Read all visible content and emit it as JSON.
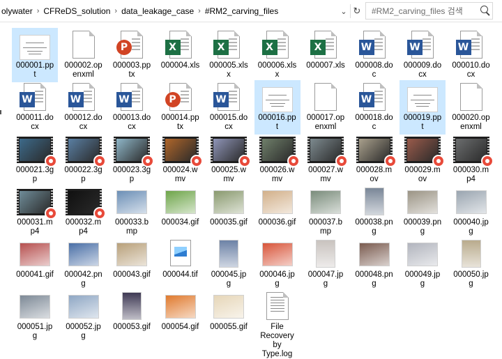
{
  "address": {
    "crumbs": [
      "olywater",
      "CFReDS_solution",
      "data_leakage_case",
      "#RM2_carving_files"
    ],
    "separator": "›",
    "dropdown_glyph": "⌄",
    "refresh_glyph": "↻"
  },
  "search": {
    "placeholder": "#RM2_carving_files 검색"
  },
  "files": [
    {
      "line1": "000001.pp",
      "line2": "t",
      "kind": "ppt-thumb",
      "selected": true
    },
    {
      "line1": "000002.op",
      "line2": "enxml",
      "kind": "blank"
    },
    {
      "line1": "000003.pp",
      "line2": "tx",
      "kind": "ppt"
    },
    {
      "line1": "000004.xls",
      "line2": "",
      "kind": "xls"
    },
    {
      "line1": "000005.xls",
      "line2": "x",
      "kind": "xls"
    },
    {
      "line1": "000006.xls",
      "line2": "x",
      "kind": "xls"
    },
    {
      "line1": "000007.xls",
      "line2": "",
      "kind": "xls"
    },
    {
      "line1": "000008.do",
      "line2": "c",
      "kind": "doc"
    },
    {
      "line1": "000009.do",
      "line2": "cx",
      "kind": "doc"
    },
    {
      "line1": "000010.do",
      "line2": "cx",
      "kind": "doc"
    },
    {
      "line1": "000011.do",
      "line2": "cx",
      "kind": "doc"
    },
    {
      "line1": "000012.do",
      "line2": "cx",
      "kind": "doc"
    },
    {
      "line1": "000013.do",
      "line2": "cx",
      "kind": "doc"
    },
    {
      "line1": "000014.pp",
      "line2": "tx",
      "kind": "ppt"
    },
    {
      "line1": "000015.do",
      "line2": "cx",
      "kind": "doc"
    },
    {
      "line1": "000016.pp",
      "line2": "t",
      "kind": "ppt-thumb",
      "selected": true
    },
    {
      "line1": "000017.op",
      "line2": "enxml",
      "kind": "blank"
    },
    {
      "line1": "000018.do",
      "line2": "c",
      "kind": "doc"
    },
    {
      "line1": "000019.pp",
      "line2": "t",
      "kind": "ppt-thumb",
      "selected": true
    },
    {
      "line1": "000020.op",
      "line2": "enxml",
      "kind": "blank"
    },
    {
      "line1": "000021.3g",
      "line2": "p",
      "kind": "video",
      "color": "#3d6a8a"
    },
    {
      "line1": "000022.3g",
      "line2": "p",
      "kind": "video",
      "color": "#5a7fa3"
    },
    {
      "line1": "000023.3g",
      "line2": "p",
      "kind": "video",
      "color": "#8fb7c9"
    },
    {
      "line1": "000024.w",
      "line2": "mv",
      "kind": "video",
      "color": "#b0662a"
    },
    {
      "line1": "000025.w",
      "line2": "mv",
      "kind": "video",
      "color": "#8f95b8"
    },
    {
      "line1": "000026.w",
      "line2": "mv",
      "kind": "video",
      "color": "#6f7f6a"
    },
    {
      "line1": "000027.w",
      "line2": "mv",
      "kind": "video",
      "color": "#7d8a8f"
    },
    {
      "line1": "000028.m",
      "line2": "ov",
      "kind": "video",
      "color": "#a9a08c"
    },
    {
      "line1": "000029.m",
      "line2": "ov",
      "kind": "video",
      "color": "#9a5b4b"
    },
    {
      "line1": "000030.m",
      "line2": "p4",
      "kind": "video",
      "color": "#6b6d6e"
    },
    {
      "line1": "000031.m",
      "line2": "p4",
      "kind": "video",
      "color": "#6f8c98"
    },
    {
      "line1": "000032.m",
      "line2": "p4",
      "kind": "video",
      "color": "#101010"
    },
    {
      "line1": "000033.b",
      "line2": "mp",
      "kind": "image",
      "color": "#6c8fb6"
    },
    {
      "line1": "000034.gif",
      "line2": "",
      "kind": "image",
      "color": "#6ea54a"
    },
    {
      "line1": "000035.gif",
      "line2": "",
      "kind": "image",
      "color": "#8a9a6f"
    },
    {
      "line1": "000036.gif",
      "line2": "",
      "kind": "image",
      "color": "#d2b08a"
    },
    {
      "line1": "000037.b",
      "line2": "mp",
      "kind": "image",
      "color": "#7a8c7b"
    },
    {
      "line1": "000038.pn",
      "line2": "g",
      "kind": "image-tall",
      "color": "#7a8798"
    },
    {
      "line1": "000039.pn",
      "line2": "g",
      "kind": "image",
      "color": "#9b9485"
    },
    {
      "line1": "000040.jp",
      "line2": "g",
      "kind": "image",
      "color": "#9aa5b0"
    },
    {
      "line1": "000041.gif",
      "line2": "",
      "kind": "image",
      "color": "#b6504f"
    },
    {
      "line1": "000042.pn",
      "line2": "g",
      "kind": "image",
      "color": "#4a6fa6"
    },
    {
      "line1": "000043.gif",
      "line2": "",
      "kind": "image",
      "color": "#b8a07a"
    },
    {
      "line1": "000044.tif",
      "line2": "",
      "kind": "tif"
    },
    {
      "line1": "000045.jp",
      "line2": "g",
      "kind": "image-tall",
      "color": "#6d82a6"
    },
    {
      "line1": "000046.jp",
      "line2": "g",
      "kind": "image",
      "color": "#d8553a"
    },
    {
      "line1": "000047.jp",
      "line2": "g",
      "kind": "image-tall",
      "color": "#c9c3bf"
    },
    {
      "line1": "000048.pn",
      "line2": "g",
      "kind": "image",
      "color": "#7a5b4f"
    },
    {
      "line1": "000049.jp",
      "line2": "g",
      "kind": "image",
      "color": "#b1b4bd"
    },
    {
      "line1": "000050.jp",
      "line2": "g",
      "kind": "image-tall",
      "color": "#b9ab8d"
    },
    {
      "line1": "000051.jp",
      "line2": "g",
      "kind": "image",
      "color": "#7d8996"
    },
    {
      "line1": "000052.jp",
      "line2": "g",
      "kind": "image",
      "color": "#8fa7c4"
    },
    {
      "line1": "000053.gif",
      "line2": "",
      "kind": "image-tall",
      "color": "#3f3a55"
    },
    {
      "line1": "000054.gif",
      "line2": "",
      "kind": "image",
      "color": "#e07a2e"
    },
    {
      "line1": "000055.gif",
      "line2": "",
      "kind": "image",
      "color": "#e6d6b8"
    },
    {
      "line1": "File",
      "line2": "Recovery",
      "line3": "by",
      "line4": "Type.log",
      "kind": "log"
    }
  ]
}
